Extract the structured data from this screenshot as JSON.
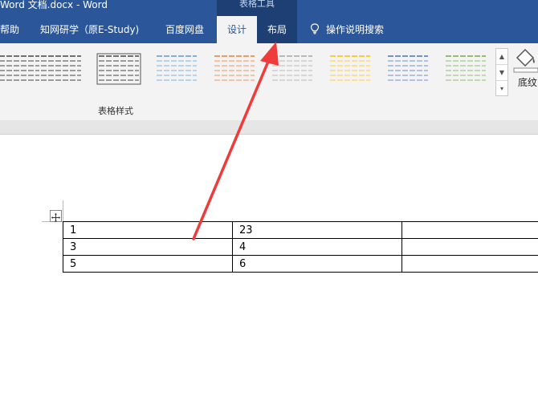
{
  "title_bar": {
    "text": "Word 文档.docx  -  Word",
    "context_group": "表格工具"
  },
  "tabs": [
    {
      "label": "帮助",
      "state": "normal"
    },
    {
      "label": "知网研学（原E-Study)",
      "state": "normal"
    },
    {
      "label": "百度网盘",
      "state": "normal"
    },
    {
      "label": "设计",
      "state": "active"
    },
    {
      "label": "布局",
      "state": "context"
    },
    {
      "label": "操作说明搜索",
      "state": "search",
      "icon": "lightbulb-icon"
    }
  ],
  "ribbon": {
    "group_label": "表格样式",
    "shading_label": "底纹",
    "style_accents": [
      "#444444",
      "#444444",
      "#444444",
      "#5b9bd5",
      "#ed7d31",
      "#a5a5a5",
      "#ffc000",
      "#4472c4",
      "#70ad47"
    ]
  },
  "table": {
    "rows": [
      [
        "1",
        "23",
        ""
      ],
      [
        "3",
        "4",
        ""
      ],
      [
        "5",
        "6",
        ""
      ]
    ]
  },
  "colors": {
    "word_blue": "#2b579a",
    "context_blue": "#1e3f73",
    "arrow_red": "#ef3b3b"
  }
}
